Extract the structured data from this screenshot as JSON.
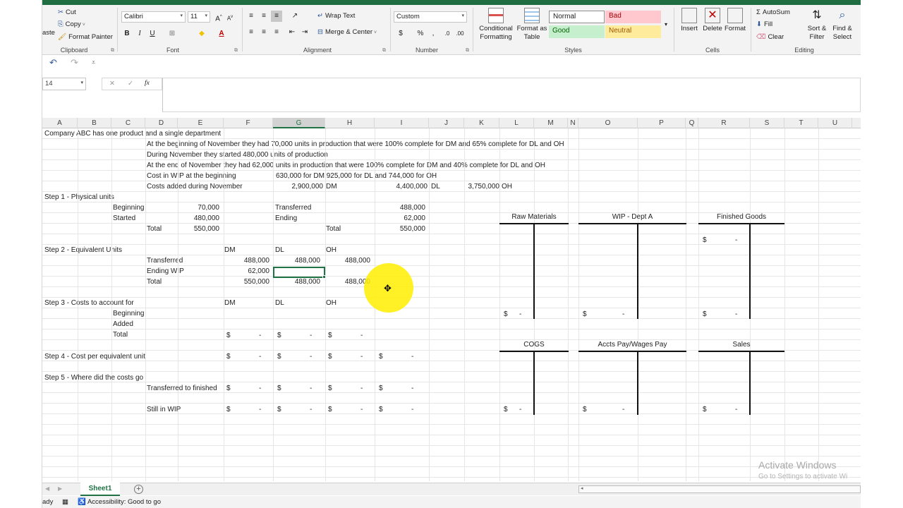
{
  "ribbon": {
    "clipboard": {
      "cut": "Cut",
      "copy": "Copy",
      "format_painter": "Format Painter",
      "paste_partial": "aste",
      "label": "Clipboard"
    },
    "font": {
      "name": "Calibri",
      "size": "11",
      "label": "Font",
      "grow": "A",
      "shrink": "A",
      "bold": "B",
      "italic": "I",
      "underline": "U"
    },
    "alignment": {
      "wrap_text": "Wrap Text",
      "merge_center": "Merge & Center",
      "label": "Alignment"
    },
    "number": {
      "format": "Custom",
      "currency": "$",
      "percent": "%",
      "comma": ",",
      "label": "Number"
    },
    "styles": {
      "conditional": [
        "Conditional",
        "Formatting"
      ],
      "format_table": [
        "Format as",
        "Table"
      ],
      "normal": "Normal",
      "bad": "Bad",
      "good": "Good",
      "neutral": "Neutral",
      "label": "Styles"
    },
    "cells": {
      "insert": "Insert",
      "delete": "Delete",
      "format": "Format",
      "label": "Cells"
    },
    "editing": {
      "autosum": "AutoSum",
      "fill": "Fill",
      "clear": "Clear",
      "sort": [
        "Sort &",
        "Filter"
      ],
      "find": [
        "Find &",
        "Select"
      ],
      "label": "Editing"
    }
  },
  "qat": {
    "undo": "↶",
    "redo": "↷"
  },
  "formula_bar": {
    "name_box": "14",
    "cancel": "✕",
    "enter": "✓",
    "fx": "fx",
    "value": ""
  },
  "columns": [
    "A",
    "B",
    "C",
    "D",
    "E",
    "F",
    "G",
    "H",
    "I",
    "J",
    "K",
    "L",
    "M",
    "N",
    "O",
    "P",
    "Q",
    "R",
    "S",
    "T",
    "U"
  ],
  "selected_column": "G",
  "sheet": {
    "intro": "Company ABC has one product and a single department",
    "line1": "At the beginning of November they had 70,000 units in production that were 100% complete for DM and 65% complete for DL and OH",
    "line2": "During November they started 480,000 units of production",
    "line3": "At the end of November they had 62,000 units in production that were 100% complete for DM and 40% complete for DL and OH",
    "wip_begin_label": "Cost in WIP at the beginning",
    "wip_begin_value": "630,000 for DM  925,000 for DL and 744,000 for OH",
    "added_label": "Costs added during November",
    "added_dm_value": "2,900,000",
    "added_dm": "DM",
    "added_dl_value": "4,400,000",
    "added_dl": "DL",
    "added_oh_value": "3,750,000",
    "added_oh": "OH",
    "step1": {
      "title": "Step 1 - Physical units",
      "beginning": "Beginning",
      "beginning_val": "70,000",
      "started": "Started",
      "started_val": "480,000",
      "total": "Total",
      "total_val": "550,000",
      "transferred": "Transferred",
      "transferred_val": "488,000",
      "ending": "Ending",
      "ending_val": "62,000",
      "total2": "Total",
      "total2_val": "550,000"
    },
    "step2": {
      "title": "Step 2 - Equivalent Units",
      "dm": "DM",
      "dl": "DL",
      "oh": "OH",
      "transferred": "Transferred",
      "t_dm": "488,000",
      "t_dl": "488,000",
      "t_oh": "488,000",
      "ending": "Ending WIP",
      "e_dm": "62,000",
      "total": "Total",
      "tot_dm": "550,000",
      "tot_dl": "488,000",
      "tot_oh": "488,000"
    },
    "step3": {
      "title": "Step 3 - Costs to account for",
      "dm": "DM",
      "dl": "DL",
      "oh": "OH",
      "beginning": "Beginning",
      "added": "Added",
      "total": "Total"
    },
    "step4": {
      "title": "Step 4 - Cost per equivalent unit"
    },
    "step5": {
      "title": "Step 5 - Where did the costs go",
      "transferred": "Transferred to finished",
      "still": "Still in WIP"
    },
    "dollar": "$",
    "dash": "-"
  },
  "t_accounts": {
    "raw_materials": "Raw Materials",
    "wip": "WIP - Dept A",
    "finished_goods": "Finished Goods",
    "cogs": "COGS",
    "accts_pay": "Accts Pay/Wages Pay",
    "sales": "Sales"
  },
  "watermark": {
    "title": "Activate Windows",
    "subtitle": "Go to Settings to activate Wi"
  },
  "tabs": {
    "sheet1": "Sheet1",
    "add": "+"
  },
  "status": {
    "ready": "ady",
    "accessibility": "Accessibility: Good to go"
  }
}
